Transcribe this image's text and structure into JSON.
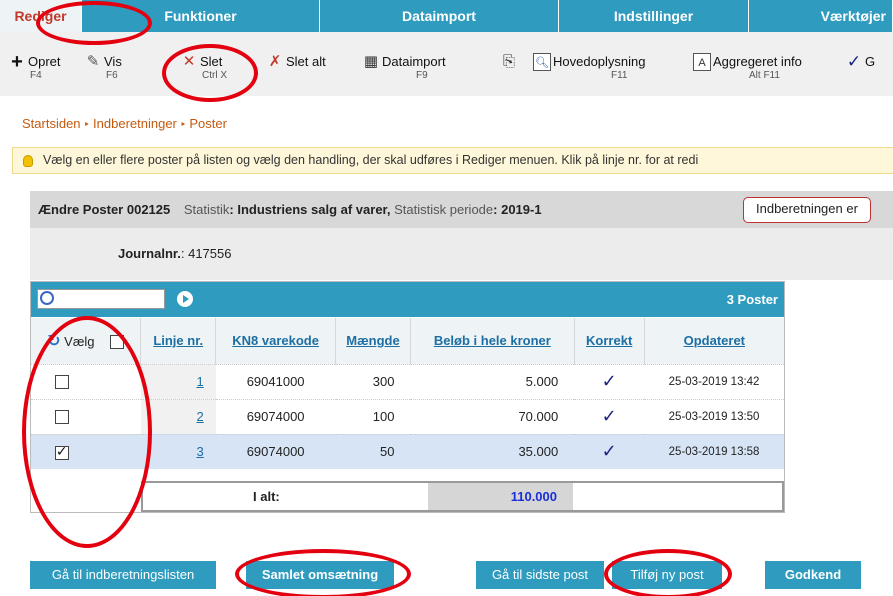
{
  "tabs": [
    {
      "label": "Rediger",
      "active": true
    },
    {
      "label": "Funktioner"
    },
    {
      "label": "Dataimport"
    },
    {
      "label": "Indstillinger"
    },
    {
      "label": "Værktøjer"
    }
  ],
  "toolbar": [
    {
      "label": "Opret",
      "key": "F4",
      "icon": "plus-icon"
    },
    {
      "label": "Vis",
      "key": "F6",
      "icon": "pencil-icon"
    },
    {
      "label": "Slet",
      "key": "Ctrl X",
      "icon": "delete-x-icon"
    },
    {
      "label": "Slet alt",
      "key": "",
      "icon": "delete-all-icon"
    },
    {
      "label": "Dataimport",
      "key": "F9",
      "icon": "import-icon"
    },
    {
      "label": "",
      "key": "",
      "icon": "copy-icon"
    },
    {
      "label": "Hovedoplysning",
      "key": "F11",
      "icon": "magnifier-doc-icon"
    },
    {
      "label": "Aggregeret info",
      "key": "Alt F11",
      "icon": "aggregate-doc-icon"
    },
    {
      "label": "G",
      "key": "",
      "icon": "checkmark-icon"
    }
  ],
  "breadcrumb": [
    "Startsiden",
    "Indberetninger",
    "Poster"
  ],
  "info_text": "Vælg en eller flere poster på listen og vælg den handling, der skal udføres i Rediger menuen. Klik på linje nr. for at redi",
  "header": {
    "title": "Ændre Poster 002125",
    "stat_label": "Statistik",
    "stat_value": "Industriens salg af varer,",
    "period_label": "Statistisk periode",
    "period_value": "2019-1",
    "status_button": "Indberetningen er"
  },
  "journal": {
    "label": "Journalnr.",
    "value": "417556"
  },
  "table": {
    "count": "3 Poster",
    "select_label": "Vælg",
    "columns": [
      "Linje nr.",
      "KN8 varekode",
      "Mængde",
      "Beløb i hele kroner",
      "Korrekt",
      "Opdateret"
    ],
    "rows": [
      {
        "line": "1",
        "code": "69041000",
        "qty": "300",
        "amount": "5.000",
        "correct": true,
        "updated": "25-03-2019 13:42",
        "checked": false
      },
      {
        "line": "2",
        "code": "69074000",
        "qty": "100",
        "amount": "70.000",
        "correct": true,
        "updated": "25-03-2019 13:50",
        "checked": false
      },
      {
        "line": "3",
        "code": "69074000",
        "qty": "50",
        "amount": "35.000",
        "correct": true,
        "updated": "25-03-2019 13:58",
        "checked": true
      }
    ],
    "total_label": "I alt:",
    "total_value": "110.000"
  },
  "buttons": {
    "goto_list": "Gå til indberetningslisten",
    "total_turnover": "Samlet omsætning",
    "goto_last": "Gå til sidste post",
    "add_new": "Tilføj ny post",
    "approve": "Godkend"
  },
  "colors": {
    "accent": "#2f9bbf",
    "annotation": "#e3000f",
    "breadcrumb": "#c45a10",
    "total": "#1a2fd6"
  }
}
